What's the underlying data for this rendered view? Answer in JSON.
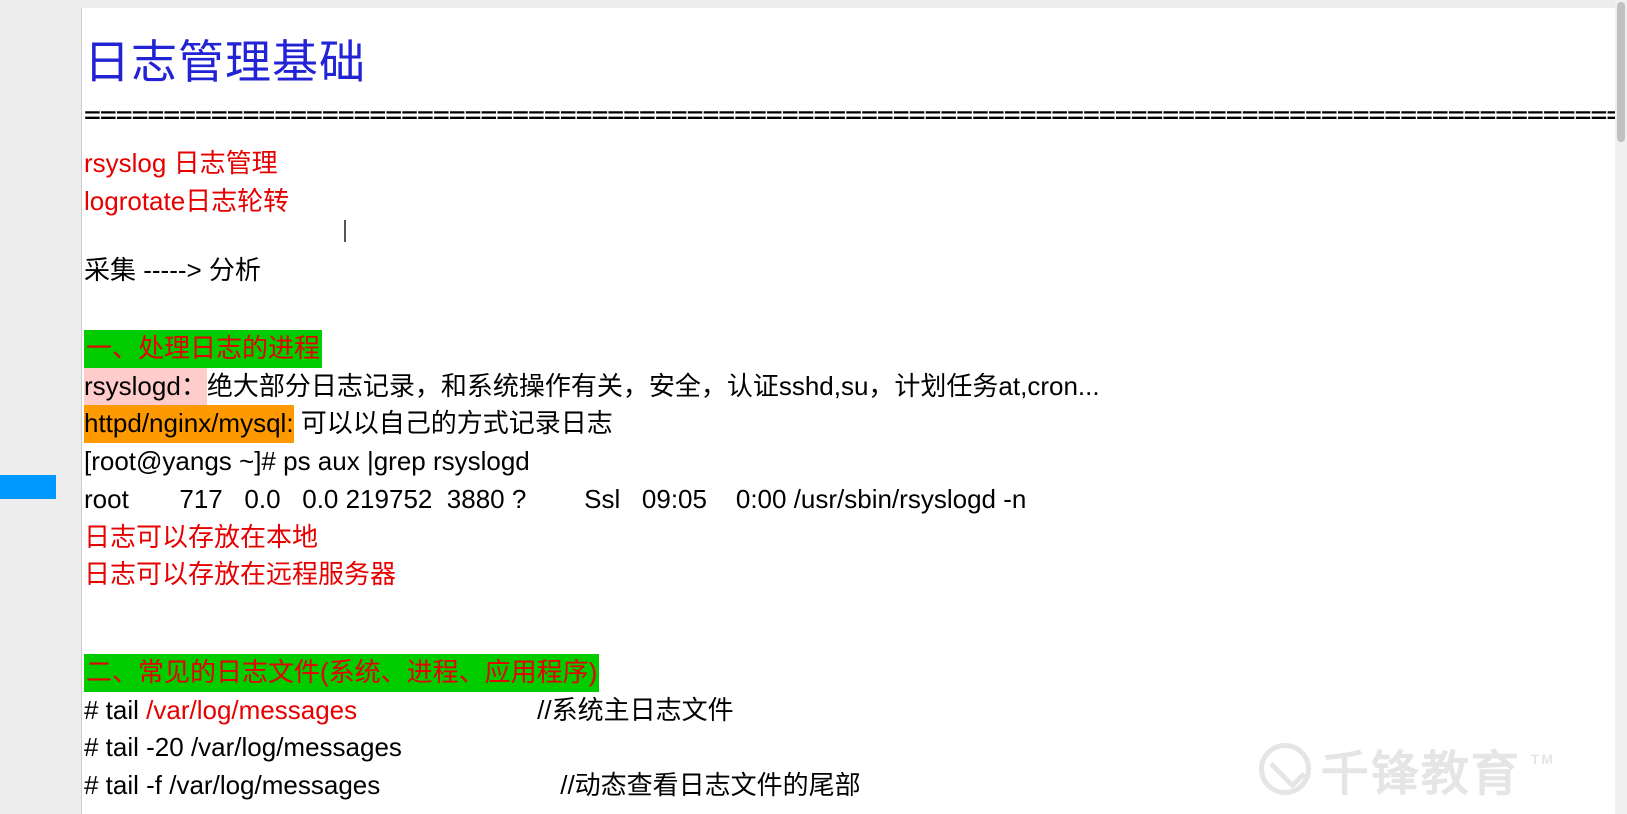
{
  "title": "日志管理基础",
  "divider": "=======================================================================================================",
  "intro": {
    "line1": "rsyslog 日志管理",
    "line2": "logrotate日志轮转",
    "flow": "采集 -----> 分析"
  },
  "section1": {
    "heading": "一、处理日志的进程",
    "rsyslogd_label": "rsyslogd：",
    "rsyslogd_desc": "绝大部分日志记录，和系统操作有关，安全，认证sshd,su，计划任务at,cron...",
    "httpd_label": "httpd/nginx/mysql:",
    "httpd_desc": " 可以以自己的方式记录日志",
    "cmd1": "[root@yangs ~]# ps aux |grep rsyslogd",
    "cmd2": "root       717   0.0   0.0 219752  3880 ?        Ssl   09:05    0:00 /usr/sbin/rsyslogd -n",
    "note1": "日志可以存放在本地",
    "note2": "日志可以存放在远程服务器"
  },
  "section2": {
    "heading": "二、常见的日志文件(系统、进程、应用程序)",
    "tail1_prefix": "# tail ",
    "tail1_path": "/var/log/messages",
    "tail1_comment": "//系统主日志文件",
    "tail2": "# tail -20 /var/log/messages",
    "tail3": "# tail -f /var/log/messages",
    "tail3_comment": "//动态查看日志文件的尾部"
  },
  "watermark": {
    "text": "千锋教育",
    "tm": "TM"
  }
}
